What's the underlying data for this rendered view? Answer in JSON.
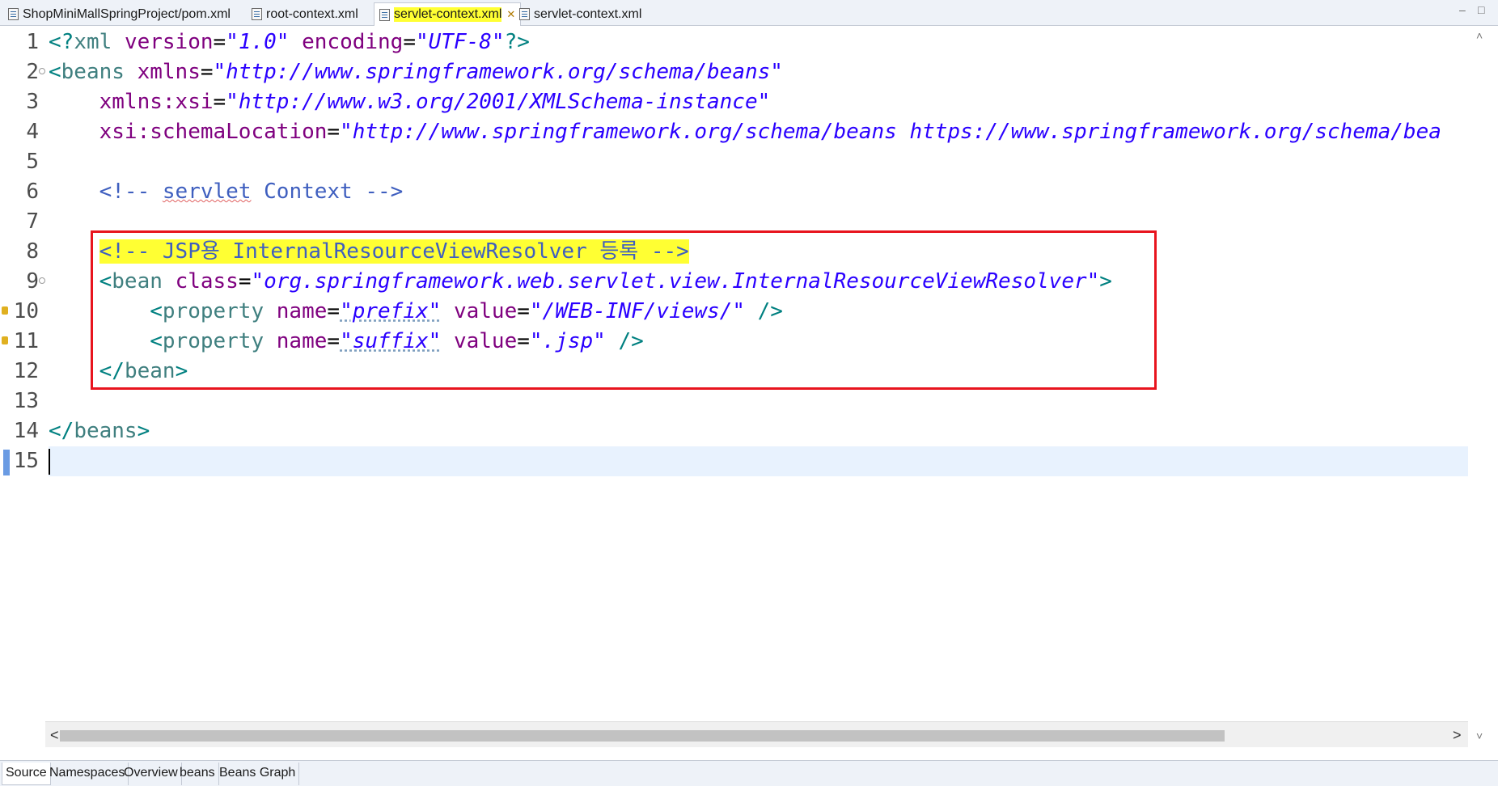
{
  "tabs": [
    {
      "label": "ShopMiniMallSpringProject/pom.xml",
      "icon": "xml-file-icon"
    },
    {
      "label": "root-context.xml",
      "icon": "spring-xml-file-icon"
    },
    {
      "label": "servlet-context.xml",
      "icon": "spring-xml-file-icon",
      "active": true,
      "close": "✕"
    },
    {
      "label": "servlet-context.xml",
      "icon": "spring-xml-file-icon"
    }
  ],
  "window_controls": {
    "minimize": "–",
    "maximize": "□"
  },
  "editor": {
    "line_numbers": [
      "1",
      "2",
      "3",
      "4",
      "5",
      "6",
      "7",
      "8",
      "9",
      "10",
      "11",
      "12",
      "13",
      "14",
      "15"
    ],
    "line1": {
      "open": "<?",
      "tag": "xml",
      "a1": "version",
      "eq": "=",
      "v1": "\"1.0\"",
      "a2": "encoding",
      "v2": "\"UTF-8\"",
      "close": "?>"
    },
    "line2": {
      "open": "<",
      "tag": "beans",
      "attr": "xmlns",
      "eq": "=",
      "val": "\"http://www.springframework.org/schema/beans\""
    },
    "line3": {
      "attr": "xmlns:xsi",
      "eq": "=",
      "val": "\"http://www.w3.org/2001/XMLSchema-instance\""
    },
    "line4": {
      "attr": "xsi:schemaLocation",
      "eq": "=",
      "val": "\"http://www.springframework.org/schema/beans https://www.springframework.org/schema/bea"
    },
    "line6": {
      "pre": "<!-- ",
      "word": "servlet",
      "post": " Context -->"
    },
    "line8": {
      "comment": "<!-- JSP용 InternalResourceViewResolver 등록 -->"
    },
    "line9": {
      "open": "<",
      "tag": "bean",
      "attr": "class",
      "eq": "=",
      "val": "\"org.springframework.web.servlet.view.InternalResourceViewResolver\"",
      "close": ">"
    },
    "line10": {
      "open": "<",
      "tag": "property",
      "a1": "name",
      "eq": "=",
      "v1": "\"prefix\"",
      "a2": "value",
      "v2": "\"/WEB-INF/views/\"",
      "close": " />"
    },
    "line11": {
      "open": "<",
      "tag": "property",
      "a1": "name",
      "eq": "=",
      "v1": "\"suffix\"",
      "a2": "value",
      "v2": "\".jsp\"",
      "close": " />"
    },
    "line12": {
      "open": "</",
      "tag": "bean",
      "close": ">"
    },
    "line14": {
      "open": "</",
      "tag": "beans",
      "close": ">"
    }
  },
  "scroll": {
    "left_arrow": "<",
    "right_arrow": ">",
    "up_arrow": "˄",
    "down_arrow": "˅"
  },
  "bottom_tabs": [
    "Source",
    "Namespaces",
    "Overview",
    "beans",
    "Beans Graph"
  ],
  "colors": {
    "tag": "#3f7f7f",
    "attribute": "#7f007f",
    "value": "#2a00ff",
    "comment": "#3f5fbf",
    "highlight": "#ffff33",
    "box": "#e8141e",
    "cursor_line": "#e8f2fe"
  }
}
